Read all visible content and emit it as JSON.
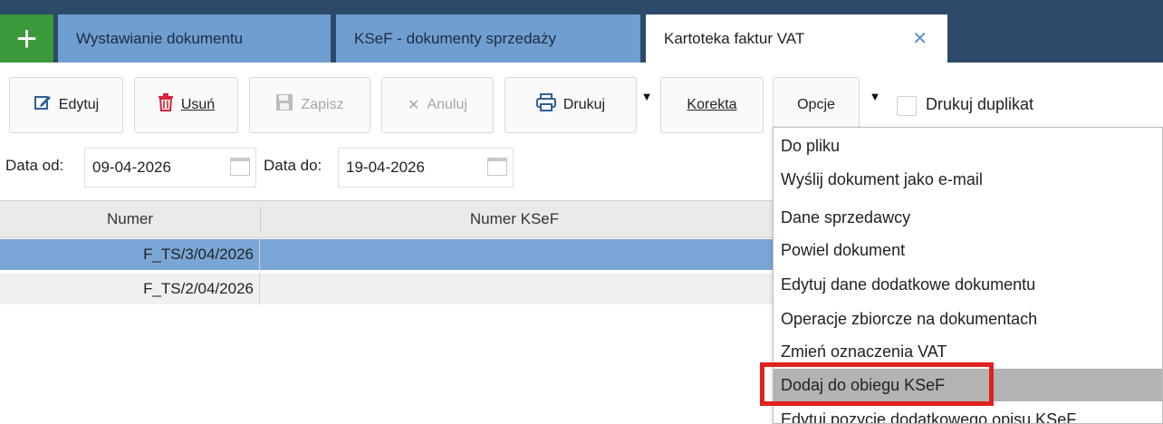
{
  "tabs": {
    "add_label": "+",
    "items": [
      {
        "label": "Wystawianie dokumentu"
      },
      {
        "label": "KSeF - dokumenty sprzedaży"
      },
      {
        "label": "Kartoteka faktur VAT"
      }
    ],
    "close_label": "✕"
  },
  "toolbar": {
    "edit_label": "Edytuj",
    "delete_label": "Usuń",
    "save_label": "Zapisz",
    "cancel_label": "Anuluj",
    "print_label": "Drukuj",
    "correction_label": "Korekta",
    "options_label": "Opcje",
    "arrow_glyph": "▼",
    "duplicate_label": "Drukuj duplikat"
  },
  "filter": {
    "from_label": "Data od:",
    "from_value": "09-04-2026",
    "to_label": "Data do:",
    "to_value": "19-04-2026"
  },
  "grid": {
    "columns": [
      "Numer",
      "Numer KSeF"
    ],
    "rows": [
      {
        "numer": "F_TS/3/04/2026",
        "ksef": "",
        "selected": true
      },
      {
        "numer": "F_TS/2/04/2026",
        "ksef": "",
        "selected": false
      }
    ]
  },
  "menu": {
    "items": [
      {
        "label": "Do pliku"
      },
      {
        "label": "Wyślij dokument jako e-mail"
      },
      {
        "label": "Dane sprzedawcy"
      },
      {
        "label": "Powiel dokument"
      },
      {
        "label": "Edytuj dane dodatkowe dokumentu"
      },
      {
        "label": "Operacje zbiorcze na dokumentach"
      },
      {
        "label": "Zmień oznaczenia VAT"
      },
      {
        "label": "Dodaj do obiegu KSeF"
      },
      {
        "label": "Edytuj pozycje dodatkowego opisu KSeF"
      }
    ],
    "highlighted_index": 7
  },
  "colors": {
    "tabbar": "#2e4a6a",
    "tab_inactive": "#6f9ed0",
    "add_button": "#3a9a3a",
    "row_selected": "#7aa6d6",
    "menu_highlight": "#b3b3b3",
    "annotation_red": "#e0221e"
  }
}
